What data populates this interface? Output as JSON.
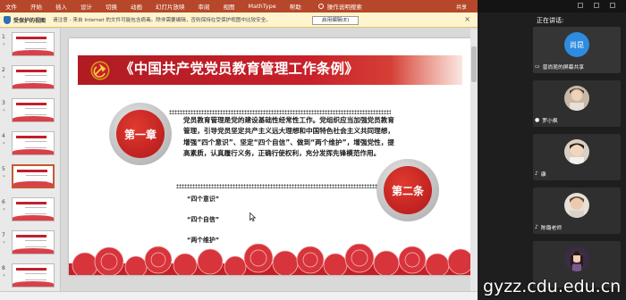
{
  "ribbon": {
    "tabs": [
      "文件",
      "开始",
      "插入",
      "设计",
      "切换",
      "动画",
      "幻灯片放映",
      "审阅",
      "视图",
      "MathType",
      "帮助"
    ],
    "tell_me": "操作说明搜索",
    "share": "共享"
  },
  "protected_view": {
    "title": "受保护的视图",
    "message": "请注意 - 来自 Internet 的文件可能包含病毒。除非需要编辑，否则保持在受保护视图中比较安全。",
    "enable_button": "启用编辑(E)",
    "close": "×"
  },
  "thumbnails": [
    {
      "num": "1",
      "star": "*",
      "selected": false
    },
    {
      "num": "2",
      "star": "*",
      "selected": false
    },
    {
      "num": "3",
      "star": "*",
      "selected": false
    },
    {
      "num": "4",
      "star": "*",
      "selected": false
    },
    {
      "num": "5",
      "star": "*",
      "selected": true
    },
    {
      "num": "6",
      "star": "*",
      "selected": false
    },
    {
      "num": "7",
      "star": "*",
      "selected": false
    },
    {
      "num": "8",
      "star": "*",
      "selected": false
    }
  ],
  "slide": {
    "title": "《中国共产党党员教育管理工作条例》",
    "chapter1": "第一章",
    "chapter2": "第二条",
    "body": "党员教育管理是党的建设基础性经常性工作。党组织应当加强党员教育管理，引导党员坚定共产主义远大理想和中国特色社会主义共同理想，增强“四个意识”、坚定“四个自信”、做到“两个维护”，增强党性，提高素质，认真履行义务，正确行使权利，充分发挥先锋模范作用。",
    "items": [
      "“四个意识”",
      "“四个自信”",
      "“两个维护”"
    ]
  },
  "meeting": {
    "speaking_label": "正在讲话:",
    "participants": [
      {
        "avatar_text": "尚昆",
        "name": "曾尚昆的屏幕共享",
        "icon": "screen-share-icon"
      },
      {
        "name": "罗小枫",
        "icon": "person-icon"
      },
      {
        "name": "康",
        "icon": "mic-icon"
      },
      {
        "name": "陈璐老师",
        "icon": "mic-icon"
      },
      {
        "name": "",
        "icon": "mic-icon"
      }
    ]
  },
  "watermark": "gyzz.cdu.edu.cn",
  "colors": {
    "ribbon": "#b7472a",
    "slide_red": "#c8202a",
    "panel_bg": "#1e1e1e",
    "avatar_blue": "#2d8ce0"
  }
}
